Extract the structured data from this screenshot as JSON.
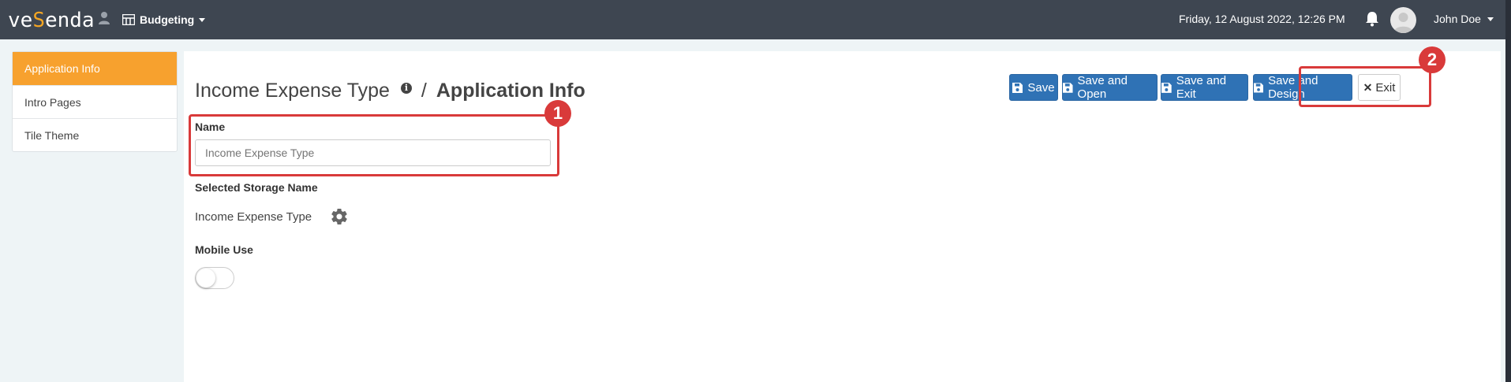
{
  "topbar": {
    "logo_left": "ve",
    "logo_mid": "S",
    "logo_right": "enda",
    "module": "Budgeting",
    "datetime": "Friday, 12 August 2022, 12:26 PM",
    "user": "John Doe"
  },
  "sidebar": {
    "items": [
      {
        "label": "Application Info",
        "active": true
      },
      {
        "label": "Intro Pages",
        "active": false
      },
      {
        "label": "Tile Theme",
        "active": false
      }
    ]
  },
  "header": {
    "parent": "Income Expense Type",
    "separator": "/",
    "current": "Application Info",
    "info_glyph": "i"
  },
  "toolbar": {
    "save": "Save",
    "save_open": "Save and Open",
    "save_exit": "Save and Exit",
    "save_design": "Save and Design",
    "exit": "Exit"
  },
  "form": {
    "name_label": "Name",
    "name_placeholder": "Income Expense Type",
    "storage_label": "Selected Storage Name",
    "storage_value": "Income Expense Type",
    "mobile_label": "Mobile Use",
    "mobile_enabled": false
  },
  "annotations": {
    "marker_1": "1",
    "marker_2": "2"
  },
  "colors": {
    "topbar": "#3e4651",
    "accent": "#f7a12e",
    "primary": "#2f72b5",
    "highlight": "#d93a3a"
  }
}
